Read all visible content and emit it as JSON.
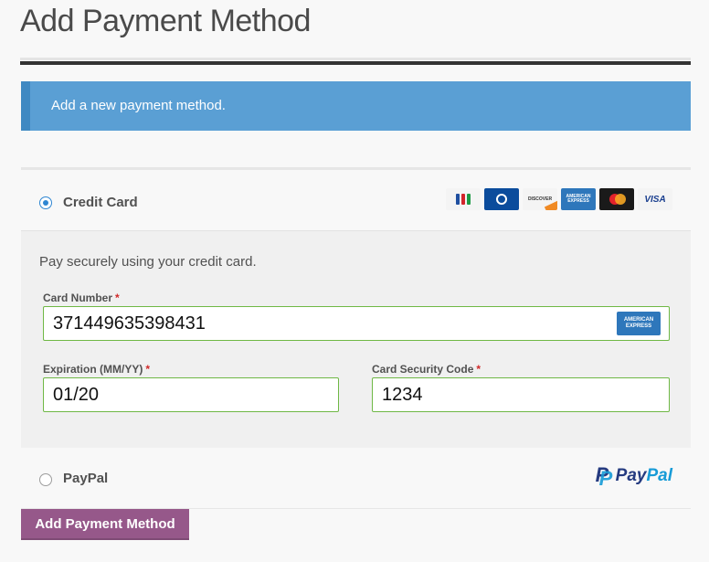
{
  "page": {
    "title": "Add Payment Method"
  },
  "notice": {
    "text": "Add a new payment method."
  },
  "methods": {
    "credit_card": {
      "label": "Credit Card",
      "selected": true,
      "card_icons": [
        "jcb-icon",
        "diners-club-icon",
        "discover-icon",
        "amex-icon",
        "mastercard-icon",
        "visa-icon"
      ],
      "card_icon_text": {
        "visa": "VISA",
        "discover": "DISCOVER",
        "amex": "AMERICAN EXPRESS"
      },
      "description": "Pay securely using your credit card.",
      "card_number": {
        "label": "Card Number",
        "required_mark": "*",
        "value": "371449635398431",
        "detected_brand": "AMERICAN EXPRESS"
      },
      "expiration": {
        "label": "Expiration (MM/YY)",
        "required_mark": "*",
        "value": "01/20"
      },
      "security_code": {
        "label": "Card Security Code",
        "required_mark": "*",
        "value": "1234"
      }
    },
    "paypal": {
      "label": "PayPal",
      "selected": false,
      "logo_text_pay": "Pay",
      "logo_text_pal": "Pal"
    }
  },
  "actions": {
    "submit_label": "Add Payment Method"
  },
  "colors": {
    "notice_bg": "#5a9fd4",
    "radio_selected": "#2f86d2",
    "field_border_valid": "#6fb845",
    "button_bg": "#96588a",
    "required_mark": "#d02a2a"
  }
}
